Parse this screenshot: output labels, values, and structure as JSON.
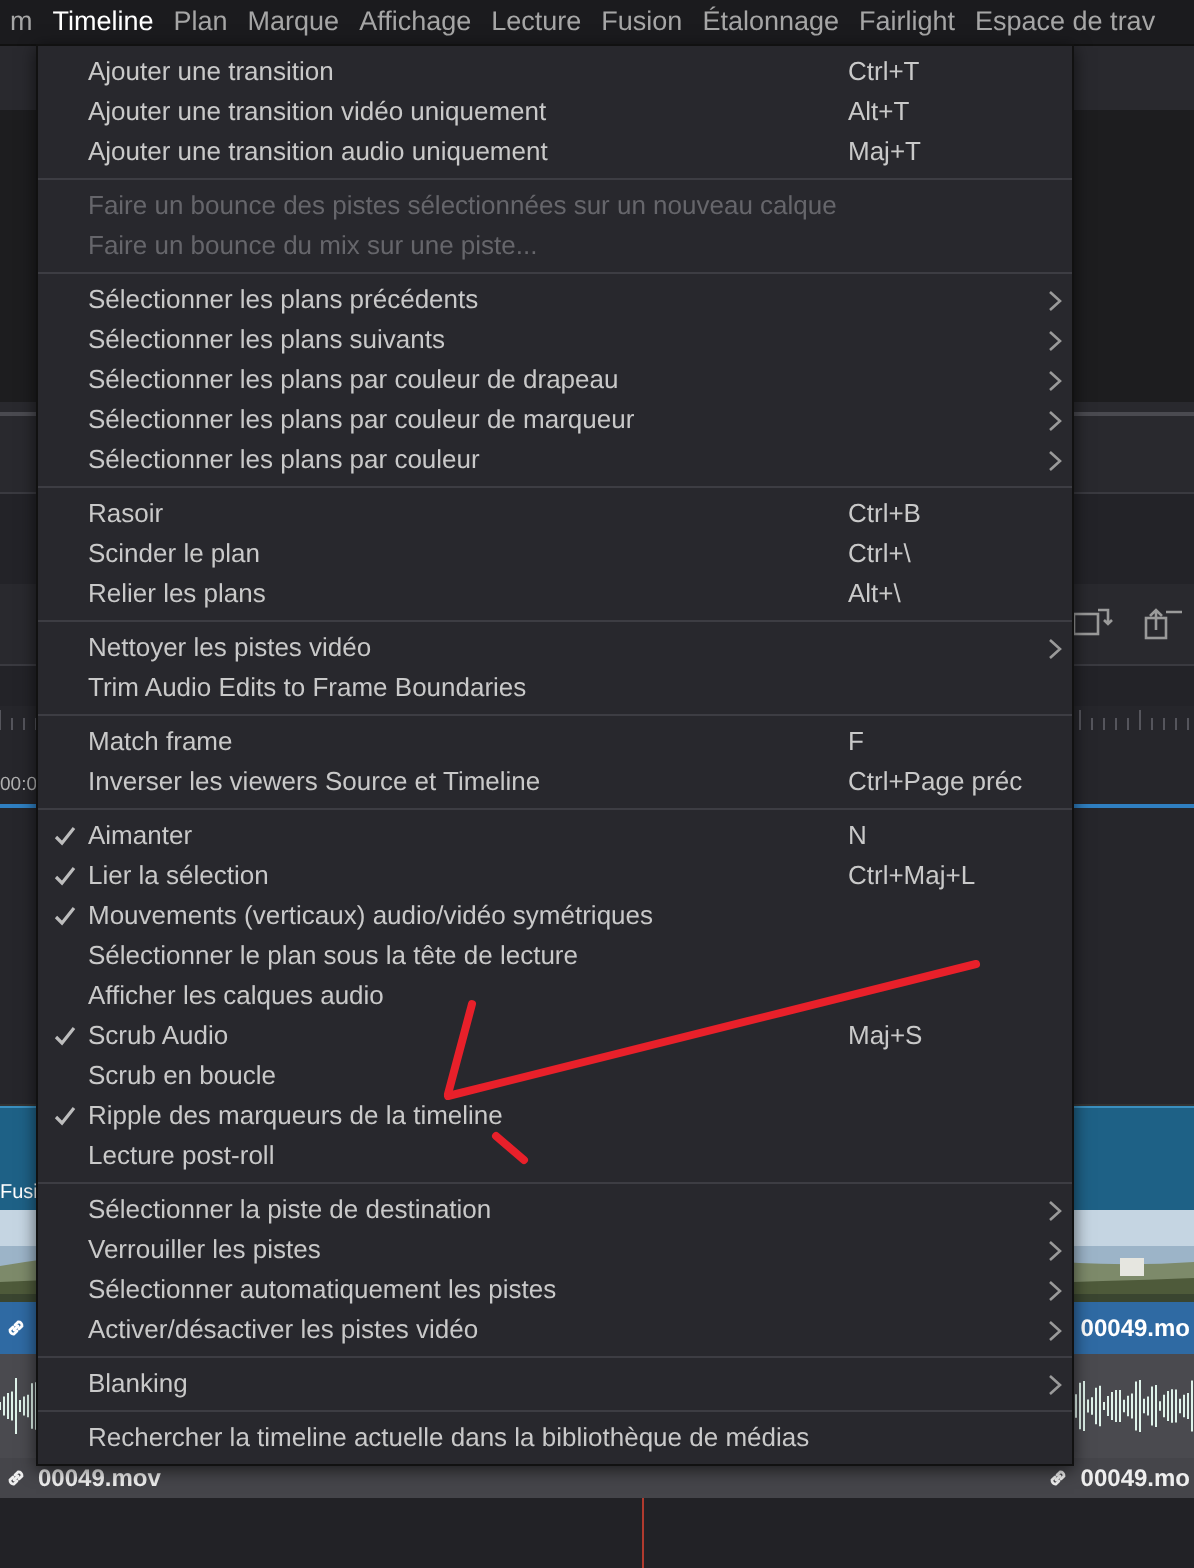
{
  "menubar": [
    {
      "label": "m",
      "selected": false
    },
    {
      "label": "Timeline",
      "selected": true
    },
    {
      "label": "Plan",
      "selected": false
    },
    {
      "label": "Marque",
      "selected": false
    },
    {
      "label": "Affichage",
      "selected": false
    },
    {
      "label": "Lecture",
      "selected": false
    },
    {
      "label": "Fusion",
      "selected": false
    },
    {
      "label": "Étalonnage",
      "selected": false
    },
    {
      "label": "Fairlight",
      "selected": false
    },
    {
      "label": "Espace de trav",
      "selected": false
    }
  ],
  "menu": {
    "sections": [
      {
        "items": [
          {
            "label": "Ajouter une transition",
            "shortcut": "Ctrl+T",
            "submenu": false,
            "disabled": false
          },
          {
            "label": "Ajouter une transition vidéo uniquement",
            "shortcut": "Alt+T",
            "submenu": false,
            "disabled": false
          },
          {
            "label": "Ajouter une transition audio uniquement",
            "shortcut": "Maj+T",
            "submenu": false,
            "disabled": false
          }
        ]
      },
      {
        "items": [
          {
            "label": "Faire un bounce des pistes sélectionnées sur un nouveau calque",
            "submenu": false,
            "disabled": true
          },
          {
            "label": "Faire un bounce du mix sur une piste...",
            "submenu": false,
            "disabled": true
          }
        ]
      },
      {
        "items": [
          {
            "label": "Sélectionner les plans précédents",
            "submenu": true,
            "disabled": false
          },
          {
            "label": "Sélectionner les plans suivants",
            "submenu": true,
            "disabled": false
          },
          {
            "label": "Sélectionner les plans par couleur de drapeau",
            "submenu": true,
            "disabled": false
          },
          {
            "label": "Sélectionner les plans par couleur de marqueur",
            "submenu": true,
            "disabled": false
          },
          {
            "label": "Sélectionner les plans par couleur",
            "submenu": true,
            "disabled": false
          }
        ]
      },
      {
        "items": [
          {
            "label": "Rasoir",
            "shortcut": "Ctrl+B",
            "submenu": false,
            "disabled": false
          },
          {
            "label": "Scinder le plan",
            "shortcut": "Ctrl+\\",
            "submenu": false,
            "disabled": false
          },
          {
            "label": "Relier les plans",
            "shortcut": "Alt+\\",
            "submenu": false,
            "disabled": false
          }
        ]
      },
      {
        "items": [
          {
            "label": "Nettoyer les pistes vidéo",
            "submenu": true,
            "disabled": false
          },
          {
            "label": "Trim Audio Edits to Frame Boundaries",
            "submenu": false,
            "disabled": false
          }
        ]
      },
      {
        "items": [
          {
            "label": "Match frame",
            "shortcut": "F",
            "submenu": false,
            "disabled": false
          },
          {
            "label": "Inverser les viewers Source et Timeline",
            "shortcut": "Ctrl+Page préc",
            "submenu": false,
            "disabled": false
          }
        ]
      },
      {
        "items": [
          {
            "label": "Aimanter",
            "shortcut": "N",
            "checked": true,
            "submenu": false,
            "disabled": false
          },
          {
            "label": "Lier la sélection",
            "shortcut": "Ctrl+Maj+L",
            "checked": true,
            "submenu": false,
            "disabled": false
          },
          {
            "label": "Mouvements (verticaux) audio/vidéo symétriques",
            "checked": true,
            "submenu": false,
            "disabled": false
          },
          {
            "label": "Sélectionner le plan sous la tête de lecture",
            "checked": false,
            "submenu": false,
            "disabled": false
          },
          {
            "label": "Afficher les calques audio",
            "checked": false,
            "submenu": false,
            "disabled": false
          },
          {
            "label": "Scrub Audio",
            "shortcut": "Maj+S",
            "checked": true,
            "submenu": false,
            "disabled": false
          },
          {
            "label": "Scrub en boucle",
            "checked": false,
            "submenu": false,
            "disabled": false
          },
          {
            "label": "Ripple des marqueurs de la timeline",
            "checked": true,
            "submenu": false,
            "disabled": false
          },
          {
            "label": "Lecture post-roll",
            "checked": false,
            "submenu": false,
            "disabled": false
          }
        ]
      },
      {
        "items": [
          {
            "label": "Sélectionner la piste de destination",
            "submenu": true,
            "disabled": false
          },
          {
            "label": "Verrouiller les pistes",
            "submenu": true,
            "disabled": false
          },
          {
            "label": "Sélectionner automatiquement les pistes",
            "submenu": true,
            "disabled": false
          },
          {
            "label": "Activer/désactiver les pistes vidéo",
            "submenu": true,
            "disabled": false
          }
        ]
      },
      {
        "items": [
          {
            "label": "Blanking",
            "submenu": true,
            "disabled": false
          }
        ]
      },
      {
        "items": [
          {
            "label": "Rechercher la timeline actuelle dans la bibliothèque de médias",
            "submenu": false,
            "disabled": false
          }
        ]
      }
    ]
  },
  "timeline": {
    "timecode": "00:0",
    "video_clip": {
      "title": "Fusi",
      "name": "00049.mo"
    },
    "audio_clips": [
      {
        "name": "00049.mov"
      },
      {
        "name": "00049.mo"
      }
    ]
  }
}
